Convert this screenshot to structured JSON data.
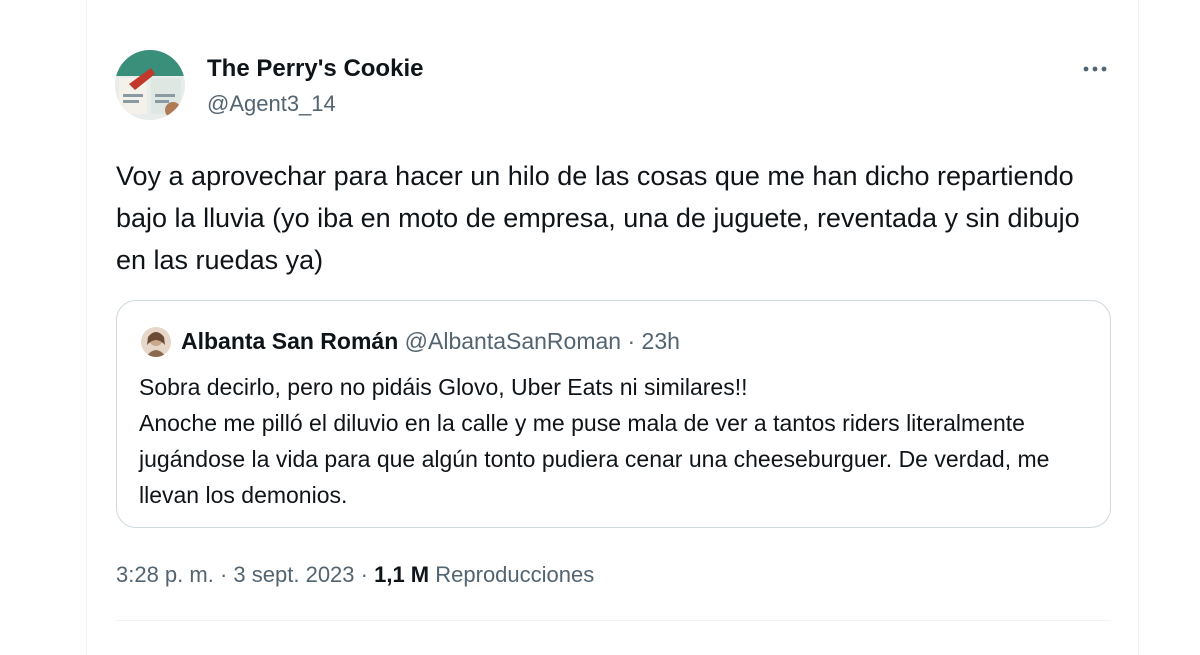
{
  "tweet": {
    "author_name": "The Perry's Cookie",
    "author_handle": "@Agent3_14",
    "more_icon": "more-horizontal-icon",
    "text": "Voy a aprovechar para hacer un hilo de las cosas que me han dicho repartiendo bajo la lluvia (yo iba en moto de empresa, una de juguete, reventada y sin dibujo en las ruedas ya)",
    "time": "3:28 p. m.",
    "separator": "·",
    "date": "3 sept. 2023",
    "views_count": "1,1 M",
    "views_label": "Reproducciones"
  },
  "quoted": {
    "author_name": "Albanta San Román",
    "author_handle": "@AlbantaSanRoman",
    "separator": "·",
    "time": "23h",
    "lines": [
      "Sobra decirlo, pero no pidáis Glovo, Uber Eats ni similares!!",
      "Anoche me pilló el diluvio en la calle y me puse mala de ver a tantos riders literalmente jugándose la vida para que algún tonto pudiera cenar una cheeseburguer. De verdad, me llevan los demonios."
    ]
  },
  "colors": {
    "text_primary": "#0f1419",
    "text_secondary": "#536471",
    "border": "#cfd9de",
    "divider": "#eff3f4"
  }
}
